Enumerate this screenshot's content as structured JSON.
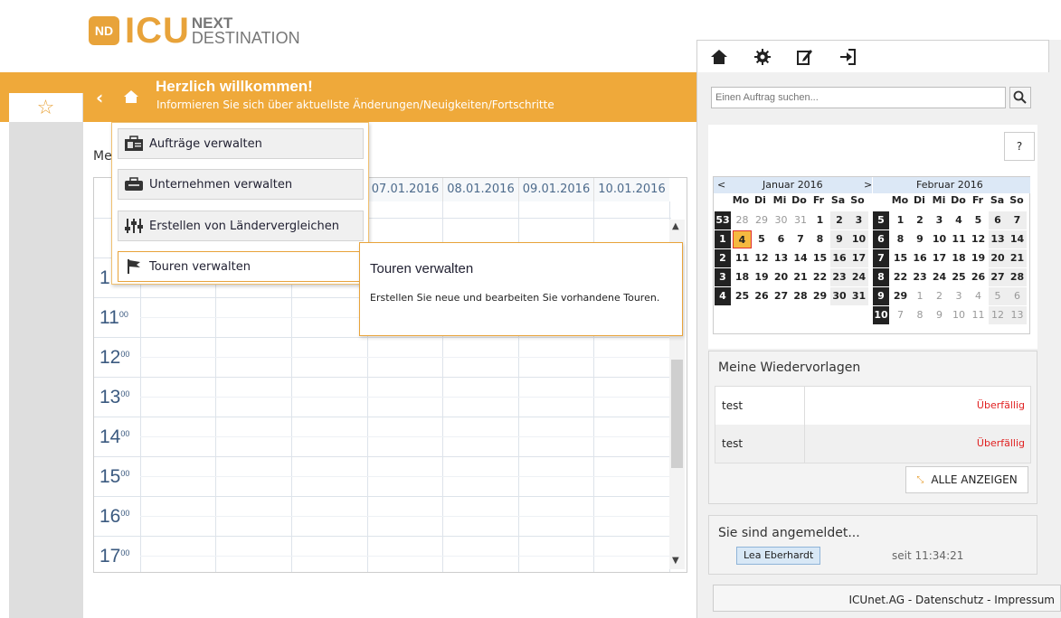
{
  "logo": {
    "mark": "ND",
    "brand": "ICU",
    "next": "NEXT",
    "destination": "DESTINATION"
  },
  "banner": {
    "back": "‹",
    "title": "Herzlich willkommen!",
    "subtitle": "Informieren Sie sich über aktuellste Änderungen/Neuigkeiten/Fortschritte"
  },
  "rail": {
    "favorite_icon": "star-icon"
  },
  "main": {
    "title_partial": "Me",
    "day_headers": [
      "07.01.2016",
      "08.01.2016",
      "09.01.2016",
      "10.01.2016"
    ],
    "hours": [
      "11",
      "12",
      "13",
      "14",
      "15",
      "16",
      "17"
    ],
    "partial_hour": "1",
    "minutes": "00"
  },
  "menu": {
    "items": [
      {
        "label": "Aufträge verwalten",
        "icon": "briefcase-id-icon"
      },
      {
        "label": "Unternehmen verwalten",
        "icon": "toolbox-icon"
      },
      {
        "label": "Erstellen von Ländervergleichen",
        "icon": "sliders-icon"
      },
      {
        "label": "Touren verwalten",
        "icon": "flag-icon"
      }
    ]
  },
  "tooltip": {
    "title": "Touren verwalten",
    "body": "Erstellen Sie neue und bearbeiten Sie vorhandene Touren."
  },
  "toolbar": {
    "icons": [
      "home-icon",
      "gear-icon",
      "edit-icon",
      "logout-icon"
    ]
  },
  "search": {
    "placeholder": "Einen Auftrag suchen..."
  },
  "help": {
    "label": "?"
  },
  "mini_calendar": {
    "prev": "<",
    "next": ">",
    "month1": "Januar 2016",
    "month2": "Februar 2016",
    "day_names": [
      "Mo",
      "Di",
      "Mi",
      "Do",
      "Fr",
      "Sa",
      "So"
    ],
    "january_weeks": [
      {
        "wk": "53",
        "days": [
          "28",
          "29",
          "30",
          "31",
          "1",
          "2",
          "3"
        ]
      },
      {
        "wk": "1",
        "days": [
          "4",
          "5",
          "6",
          "7",
          "8",
          "9",
          "10"
        ]
      },
      {
        "wk": "2",
        "days": [
          "11",
          "12",
          "13",
          "14",
          "15",
          "16",
          "17"
        ]
      },
      {
        "wk": "3",
        "days": [
          "18",
          "19",
          "20",
          "21",
          "22",
          "23",
          "24"
        ]
      },
      {
        "wk": "4",
        "days": [
          "25",
          "26",
          "27",
          "28",
          "29",
          "30",
          "31"
        ]
      }
    ],
    "february_weeks": [
      {
        "wk": "5",
        "days": [
          "1",
          "2",
          "3",
          "4",
          "5",
          "6",
          "7"
        ]
      },
      {
        "wk": "6",
        "days": [
          "8",
          "9",
          "10",
          "11",
          "12",
          "13",
          "14"
        ]
      },
      {
        "wk": "7",
        "days": [
          "15",
          "16",
          "17",
          "18",
          "19",
          "20",
          "21"
        ]
      },
      {
        "wk": "8",
        "days": [
          "22",
          "23",
          "24",
          "25",
          "26",
          "27",
          "28"
        ]
      },
      {
        "wk": "9",
        "days": [
          "29",
          "1",
          "2",
          "3",
          "4",
          "5",
          "6"
        ]
      },
      {
        "wk": "10",
        "days": [
          "7",
          "8",
          "9",
          "10",
          "11",
          "12",
          "13"
        ]
      }
    ],
    "today": "4"
  },
  "wiedervorlagen": {
    "title": "Meine Wiedervorlagen",
    "rows": [
      {
        "name": "test",
        "status": "Überfällig"
      },
      {
        "name": "test",
        "status": "Überfällig"
      }
    ],
    "all_button": "ALLE ANZEIGEN",
    "status_color": "#e02020"
  },
  "session": {
    "title": "Sie sind angemeldet...",
    "user": "Lea Eberhardt",
    "since": "seit 11:34:21"
  },
  "footer": {
    "text": "ICUnet.AG - Datenschutz - Impressum"
  },
  "colors": {
    "accent": "#efa93a",
    "link_blue": "#3b5a80"
  }
}
